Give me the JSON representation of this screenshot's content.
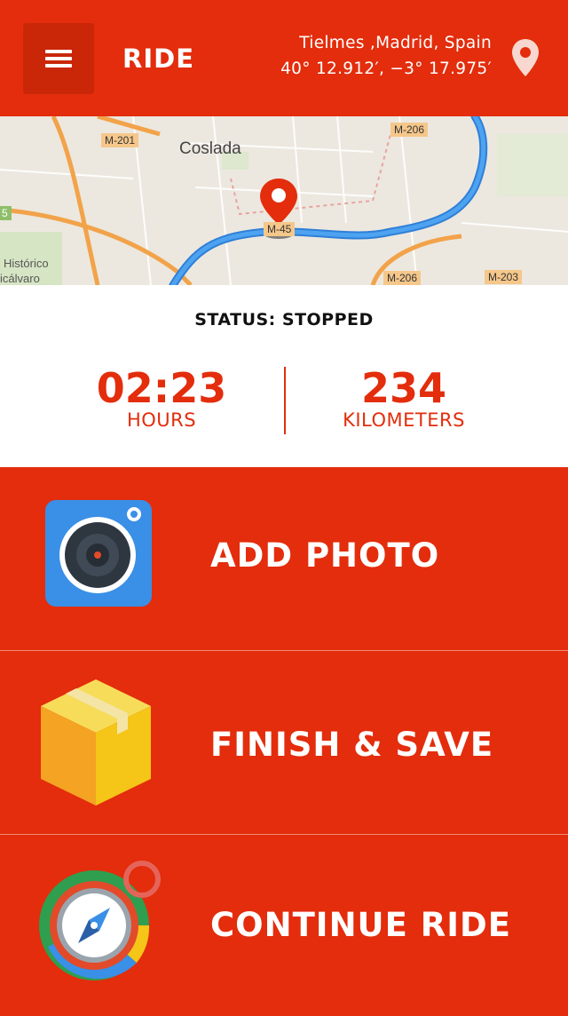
{
  "header": {
    "title": "RIDE",
    "location_name": "Tielmes ,Madrid, Spain",
    "coordinates": "40° 12.912′, −3° 17.975′",
    "icons": {
      "menu": "hamburger-menu-icon",
      "location": "map-pin-icon"
    },
    "accent_color": "#e32d0c"
  },
  "map": {
    "labels": [
      "M-201",
      "M-206",
      "M-45",
      "M-206",
      "M-203",
      "5"
    ],
    "town": "Coslada",
    "place_1": "Histórico",
    "place_2": "icálvaro",
    "route_color": "#3b8fe0"
  },
  "status": {
    "text": "STATUS: STOPPED",
    "time_value": "02:23",
    "time_unit": "HOURS",
    "distance_value": "234",
    "distance_unit": "KILOMETERS"
  },
  "actions": [
    {
      "label": "ADD PHOTO",
      "icon": "camera-icon"
    },
    {
      "label": "FINISH & SAVE",
      "icon": "box-icon"
    },
    {
      "label": "CONTINUE RIDE",
      "icon": "compass-icon"
    }
  ]
}
